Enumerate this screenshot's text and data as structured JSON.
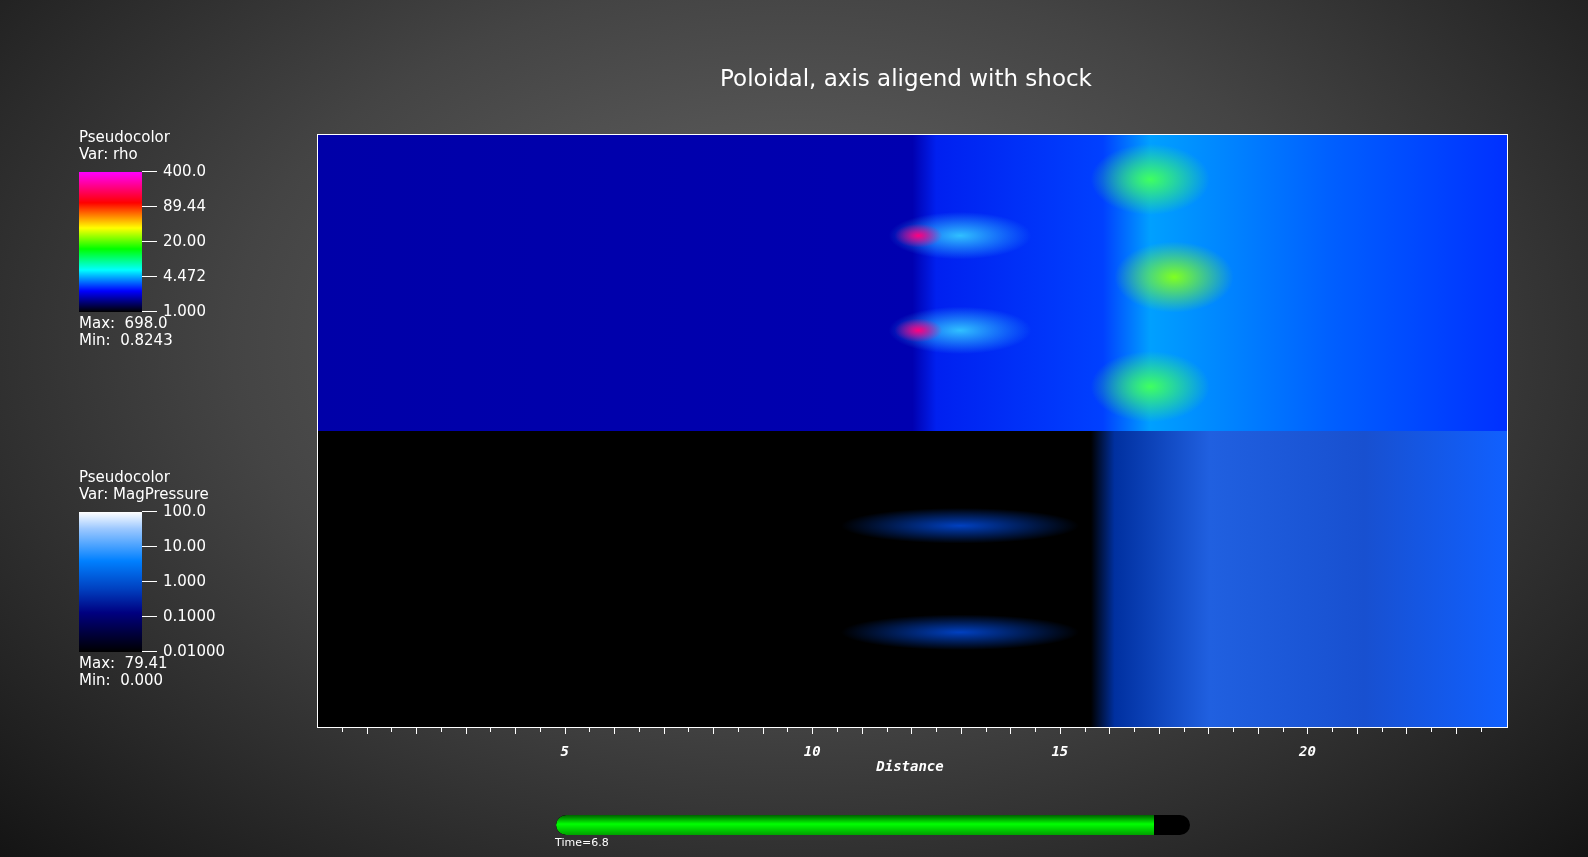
{
  "title": "Poloidal, axis aligend with shock",
  "legends": [
    {
      "kind": "rainbow",
      "heading": "Pseudocolor",
      "variable": "Var: rho",
      "ticks": [
        "400.0",
        "89.44",
        "20.00",
        "4.472",
        "1.000"
      ],
      "max": "Max:  698.0",
      "min": "Min:  0.8243"
    },
    {
      "kind": "blues",
      "heading": "Pseudocolor",
      "variable": "Var: MagPressure",
      "ticks": [
        "100.0",
        "10.00",
        "1.000",
        "0.1000",
        "0.01000"
      ],
      "max": "Max:  79.41",
      "min": "Min:  0.000"
    }
  ],
  "panels": [
    {
      "kind": "density"
    },
    {
      "kind": "magnetic"
    }
  ],
  "axis": {
    "title": "Distance",
    "ticks": [
      "5",
      "10",
      "15",
      "20"
    ]
  },
  "time_slider": {
    "label": "Time=6.8",
    "level": 0.944
  }
}
